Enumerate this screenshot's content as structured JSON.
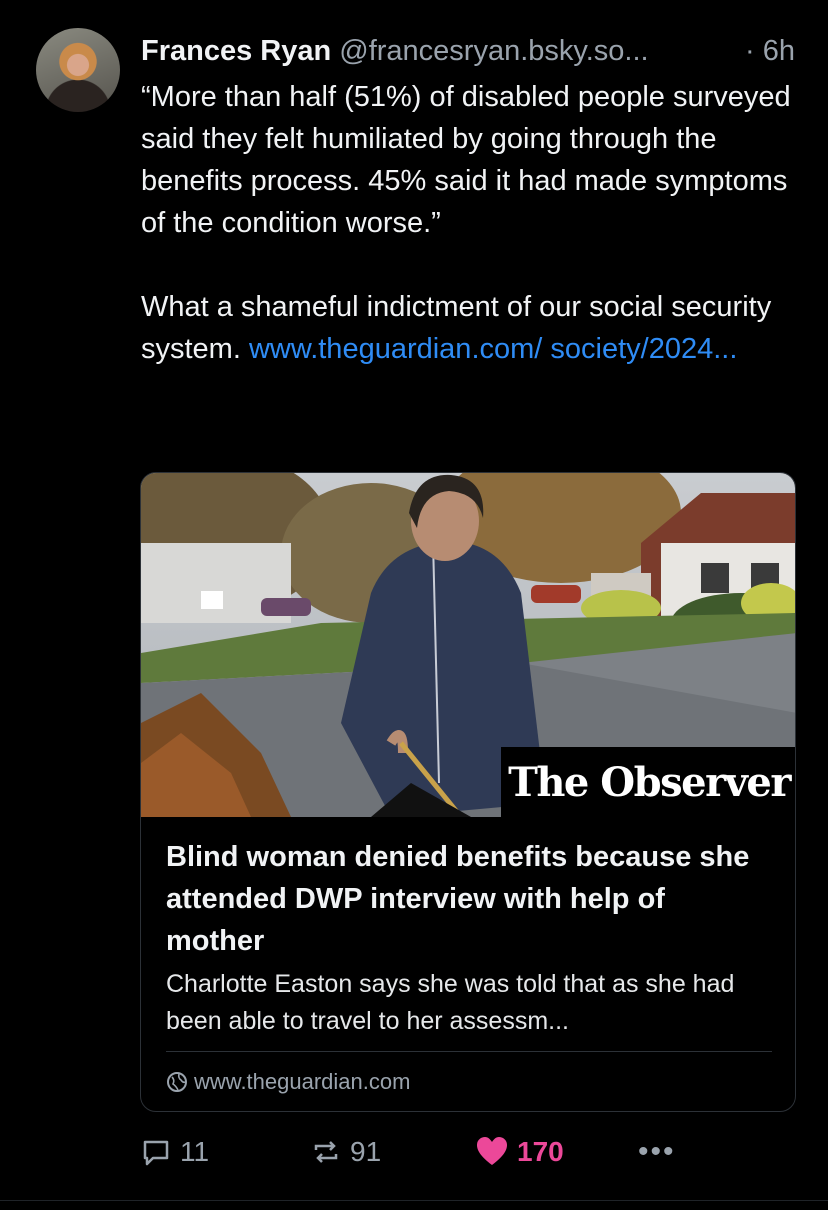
{
  "post": {
    "author_name": "Frances Ryan",
    "handle": "@francesryan.bsky.so...",
    "time": "· 6h",
    "text_quote": "“More than half (51%) of disabled people surveyed said they felt humiliated by going through the benefits process. 45% said it had made symptoms of the condition worse.”",
    "text_comment": "What a shameful indictment of our social security system. ",
    "link_text": "www.theguardian.com/ society/2024..."
  },
  "card": {
    "logo_text": "The Observer",
    "title": "Blind woman denied benefits because she attended DWP interview with help of mother",
    "description": "Charlotte Easton says she was told that as she had been able to travel to her assessm...",
    "domain": "www.theguardian.com"
  },
  "actions": {
    "replies": "11",
    "reposts": "91",
    "likes": "170",
    "more": "•••"
  },
  "colors": {
    "background": "#000000",
    "link": "#2f8cf5",
    "like": "#ec4899",
    "muted": "#9aa3ad"
  },
  "icons": [
    "avatar",
    "globe-icon",
    "reply-icon",
    "repost-icon",
    "heart-icon",
    "more-icon"
  ]
}
